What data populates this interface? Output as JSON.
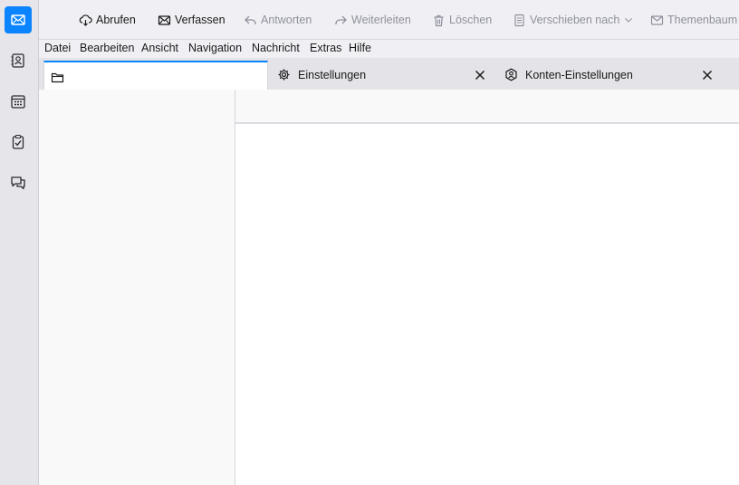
{
  "spaces": [
    {
      "name": "mail-icon",
      "active": true
    },
    {
      "name": "address-book-icon",
      "active": false
    },
    {
      "name": "calendar-icon",
      "active": false
    },
    {
      "name": "tasks-icon",
      "active": false
    },
    {
      "name": "chat-icon",
      "active": false
    }
  ],
  "toolbar": {
    "get_messages": "Abrufen",
    "write": "Verfassen",
    "reply": "Antworten",
    "forward": "Weiterleiten",
    "delete": "Löschen",
    "move_to": "Verschieben nach",
    "conversation": "Themenbaum"
  },
  "menubar": {
    "file": "Datei",
    "edit": "Bearbeiten",
    "view": "Ansicht",
    "go": "Navigation",
    "message": "Nachricht",
    "tools": "Extras",
    "help": "Hilfe"
  },
  "tabs": [
    {
      "label": "",
      "icon": "folder-icon",
      "selected": true
    },
    {
      "label": "Einstellungen",
      "icon": "gear-icon",
      "selected": false
    },
    {
      "label": "Konten-Einstellungen",
      "icon": "account-settings-icon",
      "selected": false
    }
  ],
  "colors": {
    "accent": "#0a84ff",
    "disabled_text": "#8f8f9d"
  }
}
